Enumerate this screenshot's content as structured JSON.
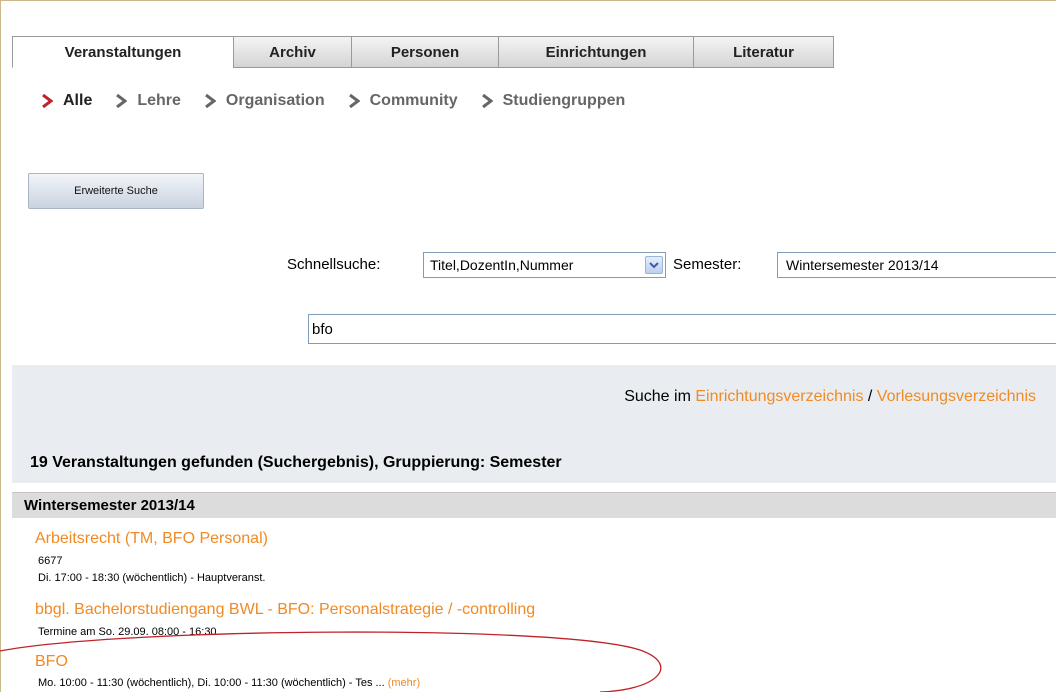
{
  "tabs": [
    {
      "label": "Veranstaltungen",
      "active": true
    },
    {
      "label": "Archiv",
      "active": false
    },
    {
      "label": "Personen",
      "active": false
    },
    {
      "label": "Einrichtungen",
      "active": false
    },
    {
      "label": "Literatur",
      "active": false
    }
  ],
  "subnav": [
    {
      "label": "Alle",
      "active": true
    },
    {
      "label": "Lehre",
      "active": false
    },
    {
      "label": "Organisation",
      "active": false
    },
    {
      "label": "Community",
      "active": false
    },
    {
      "label": "Studiengruppen",
      "active": false
    }
  ],
  "extended_search": {
    "label": "Erweiterte Suche"
  },
  "quick_search": {
    "label": "Schnellsuche:",
    "selected": "Titel,DozentIn,Nummer",
    "semester_label": "Semester:",
    "semester_value": "Wintersemester 2013/14",
    "query": "bfo"
  },
  "search_in": {
    "prefix": "Suche im",
    "link1": "Einrichtungsverzeichnis",
    "separator": "/",
    "link2": "Vorlesungsverzeichnis"
  },
  "results": {
    "heading": "19 Veranstaltungen gefunden (Suchergebnis), Gruppierung: Semester",
    "semester": "Wintersemester 2013/14",
    "courses": [
      {
        "title": "Arbeitsrecht (TM, BFO Personal)",
        "number": "6677",
        "schedule": "Di. 17:00 - 18:30 (wöchentlich) - Hauptveranst."
      },
      {
        "title": "bbgl. Bachelorstudiengang BWL - BFO: Personalstrategie / -controlling",
        "schedule": "Termine am So. 29.09. 08:00 - 16:30"
      },
      {
        "title": "BFO",
        "schedule": "Mo. 10:00 - 11:30 (wöchentlich), Di. 10:00 - 11:30 (wöchentlich) - Tes ...",
        "more": "(mehr)"
      }
    ]
  },
  "colors": {
    "accent_orange": "#f08a24",
    "annotation_red": "#c0222b",
    "panel_bg": "#e9edf2"
  }
}
